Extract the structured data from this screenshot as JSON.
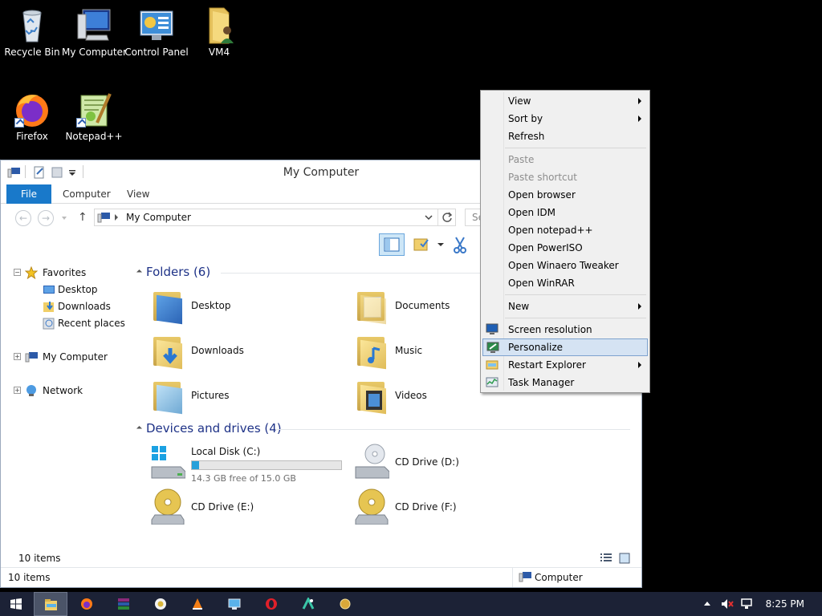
{
  "desktop": {
    "icons": [
      {
        "label": "Recycle Bin"
      },
      {
        "label": "My Computer"
      },
      {
        "label": "Control Panel"
      },
      {
        "label": "VM4"
      },
      {
        "label": "Firefox"
      },
      {
        "label": "Notepad++"
      }
    ]
  },
  "window": {
    "title": "My Computer",
    "ribbon_tabs": [
      "File",
      "Computer",
      "View"
    ],
    "address_path": "My Computer",
    "search_placeholder": "Se",
    "nav": {
      "favorites": "Favorites",
      "desktop": "Desktop",
      "downloads": "Downloads",
      "recent": "Recent places",
      "computer": "My Computer",
      "network": "Network"
    },
    "groups": {
      "folders": "Folders (6)",
      "devices": "Devices and drives (4)"
    },
    "folders": [
      "Desktop",
      "Documents",
      "Downloads",
      "Music",
      "Pictures",
      "Videos"
    ],
    "drives": [
      {
        "name": "Local Disk (C:)",
        "free": "14.3 GB free of 15.0 GB",
        "used_fraction": 0.047
      },
      {
        "name": "CD Drive (D:)"
      },
      {
        "name": "CD Drive (E:)"
      },
      {
        "name": "CD Drive (F:)"
      }
    ],
    "inner_status": "10 items",
    "status_left": "10 items",
    "status_right": "Computer"
  },
  "context_menu": {
    "items": [
      {
        "label": "View",
        "submenu": true
      },
      {
        "label": "Sort by",
        "submenu": true
      },
      {
        "label": "Refresh"
      },
      {
        "label": "Paste",
        "disabled": true
      },
      {
        "label": "Paste shortcut",
        "disabled": true
      },
      {
        "label": "Open browser"
      },
      {
        "label": "Open IDM"
      },
      {
        "label": "Open notepad++"
      },
      {
        "label": "Open PowerISO"
      },
      {
        "label": "Open Winaero Tweaker"
      },
      {
        "label": "Open WinRAR"
      },
      {
        "label": "New",
        "submenu": true
      },
      {
        "label": "Screen resolution"
      },
      {
        "label": "Personalize",
        "highlighted": true
      },
      {
        "label": "Restart Explorer",
        "submenu": true
      },
      {
        "label": "Task Manager"
      }
    ]
  },
  "taskbar": {
    "clock": "8:25 PM",
    "pinned": [
      "windows-start",
      "file-explorer",
      "firefox",
      "winrar",
      "media-player",
      "vlc",
      "network-tool",
      "opera",
      "task-tool",
      "photo-tool"
    ]
  },
  "colors": {
    "accent": "#1979ca",
    "highlight": "#d5e3f3",
    "taskbar": "#1c2236",
    "folder_group_text": "#1e3287"
  }
}
